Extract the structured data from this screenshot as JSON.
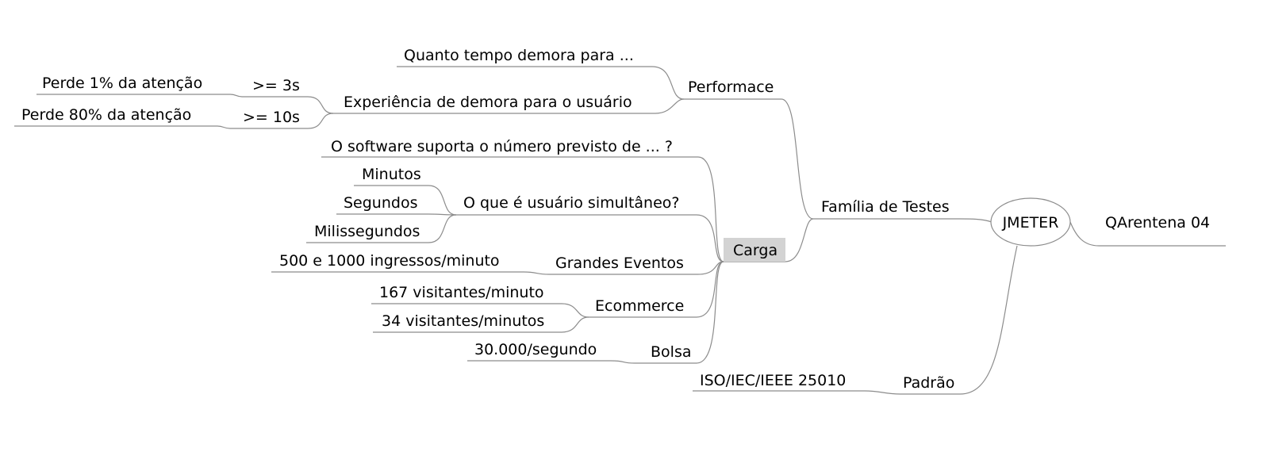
{
  "colors": {
    "line": "#8c8c8c",
    "carga_highlight": "#d3d3d3",
    "text": "#000000",
    "background": "#ffffff"
  },
  "nodes": {
    "root": "JMETER",
    "qarentena": "QArentena 04",
    "familia": "Família de Testes",
    "padrao": "Padrão",
    "iso": "ISO/IEC/IEEE 25010",
    "performace": "Performace",
    "quanto_tempo": "Quanto tempo demora para ...",
    "experiencia": "Experiência de demora para o usuário",
    "ge3s": ">= 3s",
    "ge10s": ">= 10s",
    "perde1": "Perde 1% da atenção",
    "perde80": "Perde 80% da atenção",
    "carga": "Carga",
    "software_suporta": "O software suporta o número previsto de ... ?",
    "usuario_simultaneo": "O que é usuário simultâneo?",
    "minutos": "Minutos",
    "segundos": "Segundos",
    "milissegundos": "Milissegundos",
    "grandes_eventos": "Grandes Eventos",
    "ingressos": "500 e 1000 ingressos/minuto",
    "ecommerce": "Ecommerce",
    "visitantes167": "167 visitantes/minuto",
    "visitantes34": "34 visitantes/minutos",
    "bolsa": "Bolsa",
    "trinta_mil": "30.000/segundo"
  }
}
